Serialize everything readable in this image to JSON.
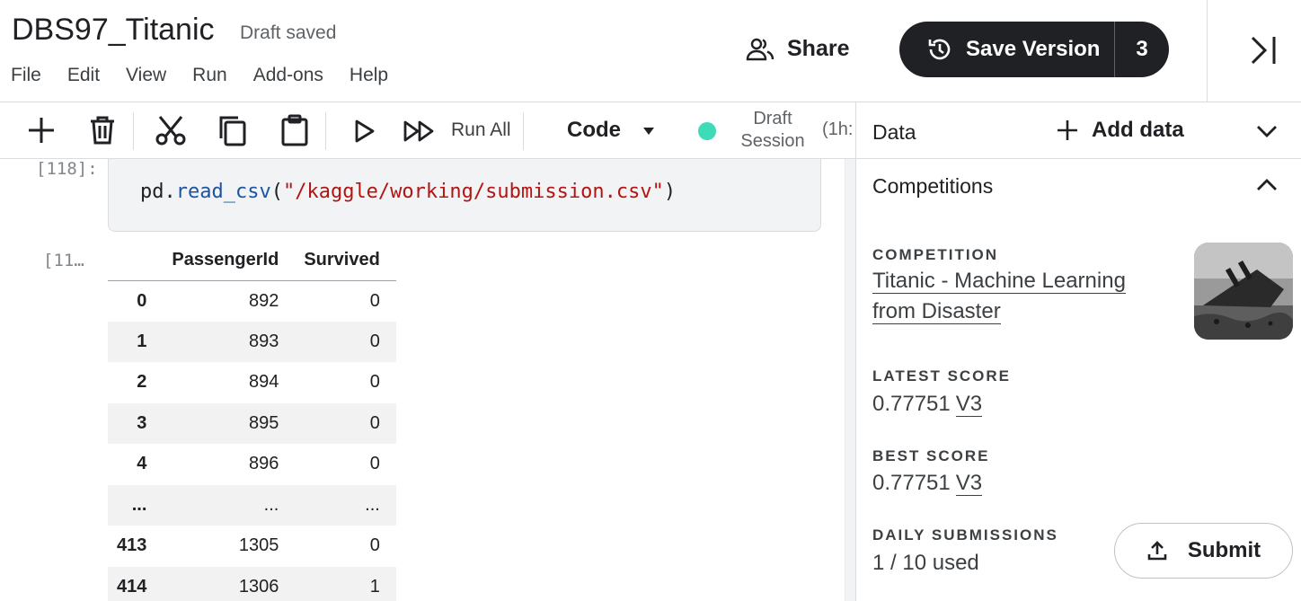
{
  "header": {
    "title": "DBS97_Titanic",
    "draft_status": "Draft saved",
    "menu": [
      "File",
      "Edit",
      "View",
      "Run",
      "Add-ons",
      "Help"
    ],
    "share_label": "Share",
    "save_version_label": "Save Version",
    "save_version_count": "3"
  },
  "toolbar": {
    "run_all_label": "Run All",
    "cell_type": "Code",
    "session_label": "Draft Session",
    "session_time": "(1h:",
    "status_color": "#3ddbb8",
    "icons": [
      "add-cell-icon",
      "delete-icon",
      "cut-icon",
      "copy-icon",
      "paste-icon",
      "run-icon",
      "run-all-icon"
    ]
  },
  "notebook": {
    "code_prompt": "[118]:",
    "output_prompt": "[11…",
    "code": {
      "prefix": "pd.",
      "function": "read_csv",
      "open": "(",
      "argument": "\"/kaggle/working/submission.csv\"",
      "close": ")"
    },
    "table": {
      "columns": [
        "",
        "PassengerId",
        "Survived"
      ],
      "rows": [
        [
          "0",
          "892",
          "0"
        ],
        [
          "1",
          "893",
          "0"
        ],
        [
          "2",
          "894",
          "0"
        ],
        [
          "3",
          "895",
          "0"
        ],
        [
          "4",
          "896",
          "0"
        ],
        [
          "...",
          "...",
          "..."
        ],
        [
          "413",
          "1305",
          "0"
        ],
        [
          "414",
          "1306",
          "1"
        ]
      ]
    }
  },
  "panel": {
    "title": "Data",
    "add_data_label": "Add data",
    "section_title": "Competitions",
    "competition_label": "COMPETITION",
    "competition_name_line1": "Titanic - Machine Learning",
    "competition_name_line2": "from Disaster",
    "latest_score_label": "LATEST SCORE",
    "latest_score": "0.77751",
    "latest_version": "V3",
    "best_score_label": "BEST SCORE",
    "best_score": "0.77751",
    "best_version": "V3",
    "daily_label": "DAILY SUBMISSIONS",
    "daily_value": "1 / 10 used",
    "submit_label": "Submit"
  }
}
